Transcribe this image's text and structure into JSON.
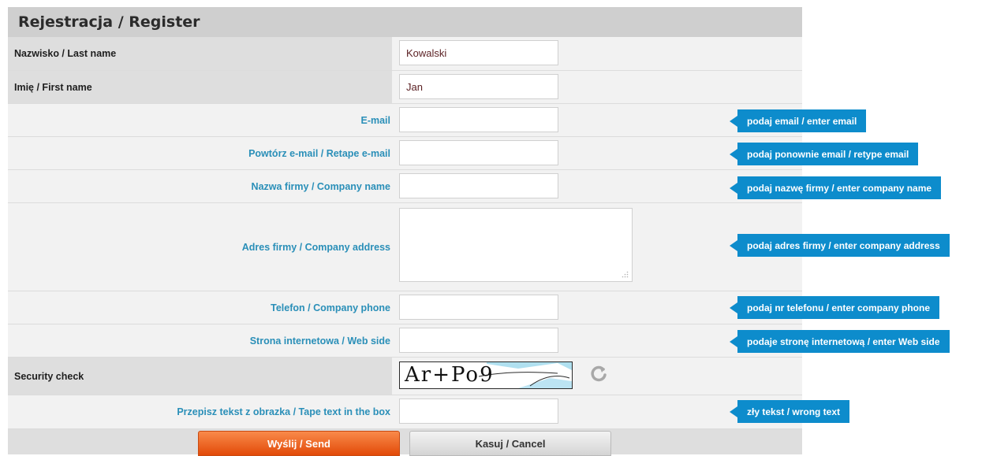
{
  "form": {
    "title": "Rejestracja / Register",
    "last_name": {
      "label": "Nazwisko / Last name",
      "value": "Kowalski"
    },
    "first_name": {
      "label": "Imię / First name",
      "value": "Jan"
    },
    "email": {
      "label": "E-mail",
      "value": "",
      "hint": "podaj email / enter email"
    },
    "email_repeat": {
      "label": "Powtórz e-mail / Retape e-mail",
      "value": "",
      "hint": "podaj ponownie email / retype email"
    },
    "company_name": {
      "label": "Nazwa firmy / Company name",
      "value": "",
      "hint": "podaj nazwę firmy / enter company name"
    },
    "company_address": {
      "label": "Adres firmy / Company address",
      "value": "",
      "hint": "podaj adres firmy / enter company address"
    },
    "phone": {
      "label": "Telefon / Company phone",
      "value": "",
      "hint": "podaj nr telefonu / enter company phone"
    },
    "website": {
      "label": "Strona internetowa / Web side",
      "value": "",
      "hint": "podaje stronę internetową / enter Web side"
    },
    "security": {
      "label": "Security check",
      "captcha_text": "Ar+Po9"
    },
    "captcha_input": {
      "label": "Przepisz tekst z obrazka / Tape text in the box",
      "value": "",
      "hint": "zły tekst / wrong text"
    },
    "send_label": "Wyślij / Send",
    "cancel_label": "Kasuj / Cancel"
  },
  "colors": {
    "accent": "#0d8ccc",
    "label_blue": "#2a8fb8",
    "send": "#e24a08",
    "header_bg": "#cfcfcf"
  }
}
